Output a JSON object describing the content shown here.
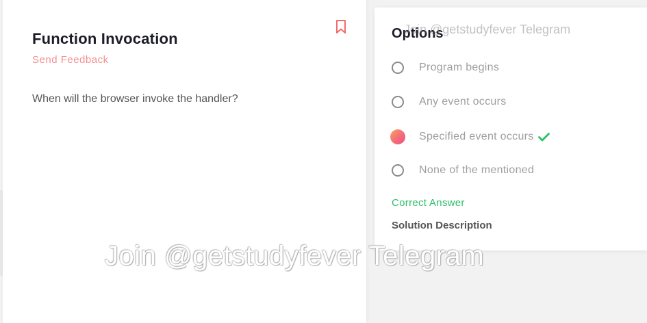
{
  "question": {
    "title": "Function Invocation",
    "feedback_link": "Send Feedback",
    "text": "When will the browser invoke the handler?",
    "bookmark_icon": "bookmark-icon"
  },
  "options_panel": {
    "heading": "Options",
    "options": [
      {
        "label": "Program begins",
        "selected": false
      },
      {
        "label": "Any event occurs",
        "selected": false
      },
      {
        "label": "Specified event occurs",
        "selected": true,
        "correct": true
      },
      {
        "label": "None of the mentioned",
        "selected": false
      }
    ],
    "correct_answer_label": "Correct Answer",
    "solution_label": "Solution Description"
  },
  "watermarks": {
    "top": "Join @getstudyfever Telegram",
    "center": "Join @getstudyfever Telegram"
  },
  "colors": {
    "feedback": "#f58f8f",
    "correct": "#2bbf6a",
    "radio_selected_gradient": [
      "#f7a35c",
      "#ef4f86"
    ],
    "bookmark": "#f26b6b"
  }
}
